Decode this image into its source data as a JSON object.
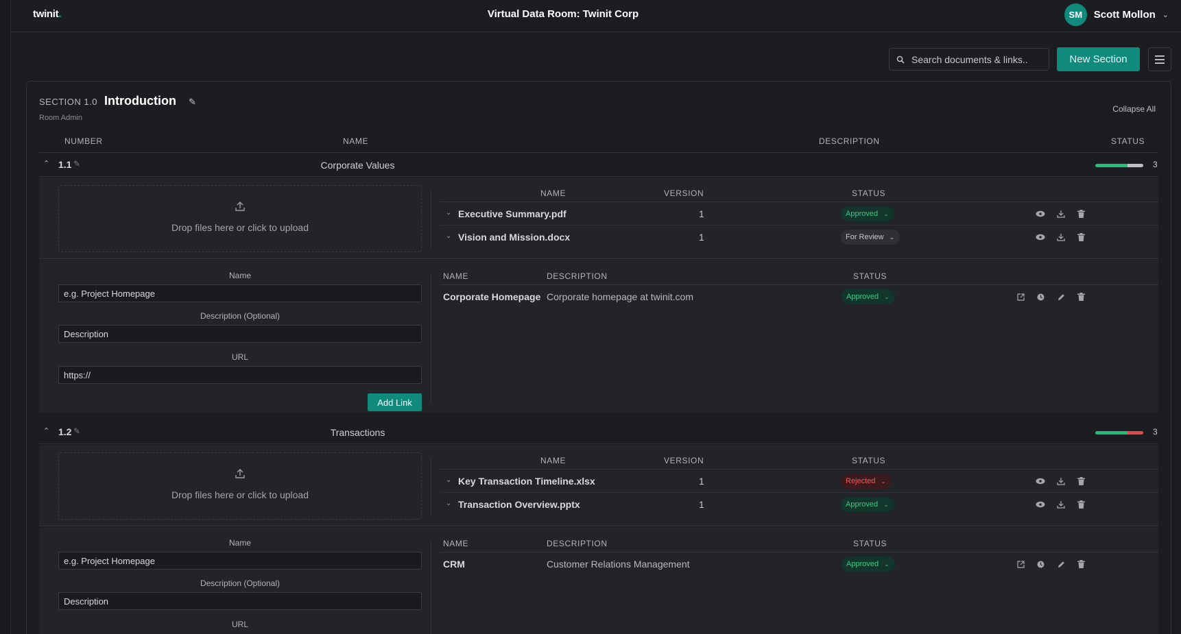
{
  "app": {
    "logo": "twinit",
    "logo_dot": ".",
    "title": "Virtual Data Room: Twinit Corp",
    "user_initials": "SM",
    "user_name": "Scott Mollon"
  },
  "toolbar": {
    "search_placeholder": "Search documents & links..",
    "new_section_label": "New Section"
  },
  "section": {
    "number_label": "SECTION 1.0",
    "title": "Introduction",
    "subtitle": "Room Admin",
    "collapse_all_label": "Collapse All",
    "columns": {
      "number": "NUMBER",
      "name": "NAME",
      "description": "DESCRIPTION",
      "status": "STATUS"
    }
  },
  "file_columns": {
    "name": "NAME",
    "version": "VERSION",
    "status": "STATUS"
  },
  "link_columns": {
    "name": "NAME",
    "description": "DESCRIPTION",
    "status": "STATUS"
  },
  "upload_text": "Drop files here or click to upload",
  "link_form": {
    "name_label": "Name",
    "name_placeholder": "e.g. Project Homepage",
    "description_label": "Description (Optional)",
    "description_placeholder": "Description",
    "url_label": "URL",
    "url_value": "https://",
    "add_button": "Add Link"
  },
  "subsections": [
    {
      "number": "1.1",
      "name": "Corporate Values",
      "count": "3",
      "progress": {
        "approved": 0.67,
        "review": 0.33,
        "rejected": 0
      },
      "files": [
        {
          "name": "Executive Summary.pdf",
          "version": "1",
          "status": "Approved"
        },
        {
          "name": "Vision and Mission.docx",
          "version": "1",
          "status": "For Review"
        }
      ],
      "links": [
        {
          "name": "Corporate Homepage",
          "description": "Corporate homepage at twinit.com",
          "status": "Approved"
        }
      ]
    },
    {
      "number": "1.2",
      "name": "Transactions",
      "count": "3",
      "progress": {
        "approved": 0.67,
        "review": 0,
        "rejected": 0.33
      },
      "files": [
        {
          "name": "Key Transaction Timeline.xlsx",
          "version": "1",
          "status": "Rejected"
        },
        {
          "name": "Transaction Overview.pptx",
          "version": "1",
          "status": "Approved"
        }
      ],
      "links": [
        {
          "name": "CRM",
          "description": "Customer Relations Management",
          "status": "Approved"
        }
      ]
    }
  ],
  "colors": {
    "accent": "#0f8a7c",
    "approved": "#3ecb86",
    "rejected": "#f0595a",
    "review": "#c6c8cc",
    "progress_approved": "#1fbf76",
    "progress_review": "#bfc0c4",
    "progress_rejected": "#e34848"
  },
  "icons": [
    "upload-icon",
    "search-icon",
    "hamburger-menu-icon",
    "eye-icon",
    "download-icon",
    "trash-icon",
    "external-link-icon",
    "clock-icon",
    "pencil-icon",
    "chevron-down-icon",
    "chevron-up-icon"
  ]
}
